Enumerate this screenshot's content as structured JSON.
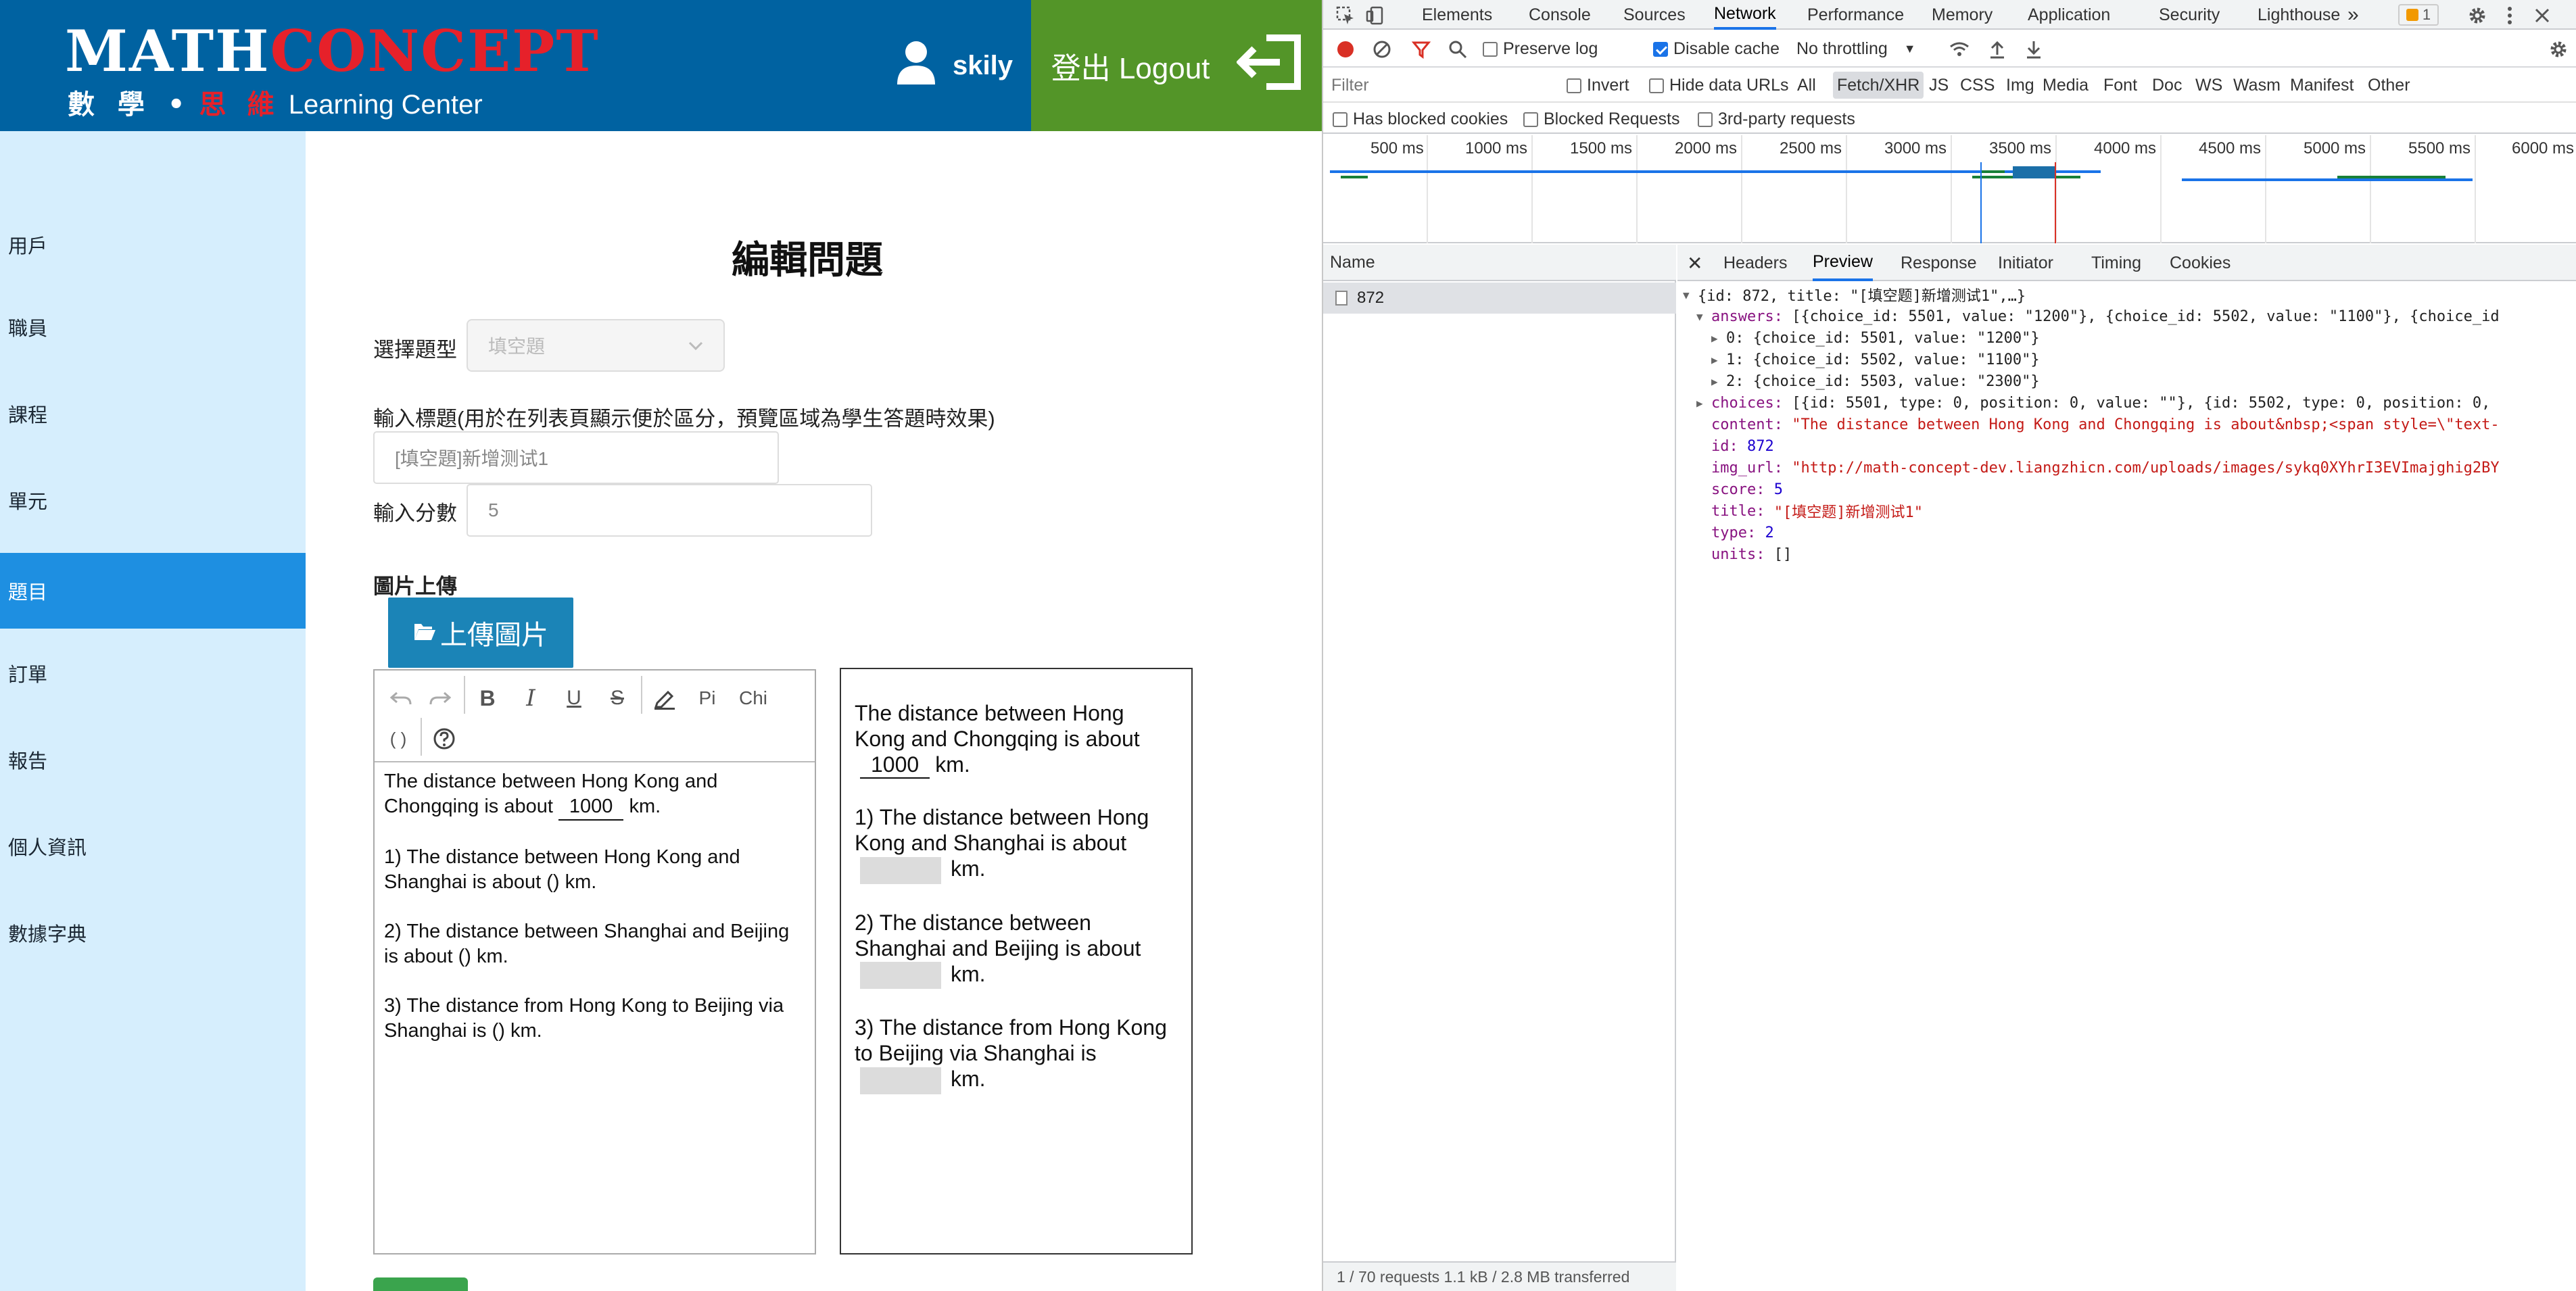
{
  "app": {
    "logo": {
      "word1": "MATH",
      "word2": "CONCEPT",
      "sub_cn1": "數 學 •",
      "sub_cn2": "思 維",
      "sub_en": "Learning Center"
    },
    "user": {
      "name": "skily"
    },
    "logout_label": "登出 Logout",
    "sidebar": [
      "用戶",
      "職員",
      "課程",
      "單元",
      "題目",
      "訂單",
      "報告",
      "個人資訊",
      "數據字典"
    ],
    "active_sidebar": "題目",
    "page_title": "編輯問題",
    "form": {
      "type_label": "選擇題型",
      "type_value": "填空題",
      "title_label": "輸入標題(用於在列表頁顯示便於區分，預覽區域為學生答題時效果)",
      "title_value": "[填空題]新增测试1",
      "score_label": "輸入分數",
      "score_value": "5",
      "image_label": "圖片上傳",
      "upload_label": "上傳圖片"
    },
    "toolbar": {
      "pi": "Pi",
      "chi": "Chi",
      "paren": "( )"
    },
    "editor": {
      "p1_a": "The distance between Hong Kong and Chongqing is about",
      "p1_blank": "1000",
      "p1_b": "km.",
      "p2": "1) The distance between Hong Kong and Shanghai is about () km.",
      "p3": "2) The distance between Shanghai and Beijing is about () km.",
      "p4": "3) The distance from Hong Kong to Beijing via Shanghai is () km."
    },
    "preview": {
      "p1_a": "The distance between Hong Kong and Chongqing is about",
      "p1_blank": "1000",
      "p1_b": "km.",
      "p2": "1) The distance between Hong Kong and Shanghai is about",
      "p3": "2) The distance between Shanghai and Beijing is about",
      "p4": "3) The distance from Hong Kong to Beijing via Shanghai is",
      "unit": "km."
    }
  },
  "devtools": {
    "tabs": [
      "Elements",
      "Console",
      "Sources",
      "Network",
      "Performance",
      "Memory",
      "Application",
      "Security",
      "Lighthouse"
    ],
    "active_tab": "Network",
    "more": "»",
    "issues_count": "1",
    "toolbar": {
      "preserve_log": "Preserve log",
      "disable_cache": "Disable cache",
      "throttling": "No throttling"
    },
    "filter": {
      "placeholder": "Filter",
      "invert": "Invert",
      "hide_data_urls": "Hide data URLs",
      "types": [
        "All",
        "Fetch/XHR",
        "JS",
        "CSS",
        "Img",
        "Media",
        "Font",
        "Doc",
        "WS",
        "Wasm",
        "Manifest",
        "Other"
      ],
      "selected_type": "Fetch/XHR",
      "has_blocked_cookies": "Has blocked cookies",
      "blocked_requests": "Blocked Requests",
      "third_party": "3rd-party requests"
    },
    "timeline_ticks": [
      "500 ms",
      "1000 ms",
      "1500 ms",
      "2000 ms",
      "2500 ms",
      "3000 ms",
      "3500 ms",
      "4000 ms",
      "4500 ms",
      "5000 ms",
      "5500 ms",
      "6000 ms"
    ],
    "name_header": "Name",
    "request_name": "872",
    "status_bar": "1 / 70 requests   1.1 kB / 2.8 MB transferred",
    "detail_tabs": [
      "Headers",
      "Preview",
      "Response",
      "Initiator",
      "Timing",
      "Cookies"
    ],
    "active_detail_tab": "Preview",
    "json": {
      "root": "{id: 872, title: \"[填空题]新增测试1\",…}",
      "answers_key": "answers:",
      "answers_val": "[{choice_id: 5501, value: \"1200\"}, {choice_id: 5502, value: \"1100\"}, {choice_id",
      "ans0": "0: {choice_id: 5501, value: \"1200\"}",
      "ans1": "1: {choice_id: 5502, value: \"1100\"}",
      "ans2": "2: {choice_id: 5503, value: \"2300\"}",
      "choices_key": "choices:",
      "choices_val": "[{id: 5501, type: 0, position: 0, value: \"\"}, {id: 5502, type: 0, position: 0,",
      "content_key": "content:",
      "content_val": "\"The distance between Hong Kong and Chongqing is about&nbsp;<span style=\\\"text-",
      "id_key": "id:",
      "id_val": "872",
      "img_key": "img_url:",
      "img_val": "\"http://math-concept-dev.liangzhicn.com/uploads/images/sykq0XYhrI3EVImajghig2BY",
      "score_key": "score:",
      "score_val": "5",
      "title_key": "title:",
      "title_val": "\"[填空题]新增测试1\"",
      "type_key": "type:",
      "type_val": "2",
      "units_key": "units:",
      "units_val": "[]"
    }
  }
}
